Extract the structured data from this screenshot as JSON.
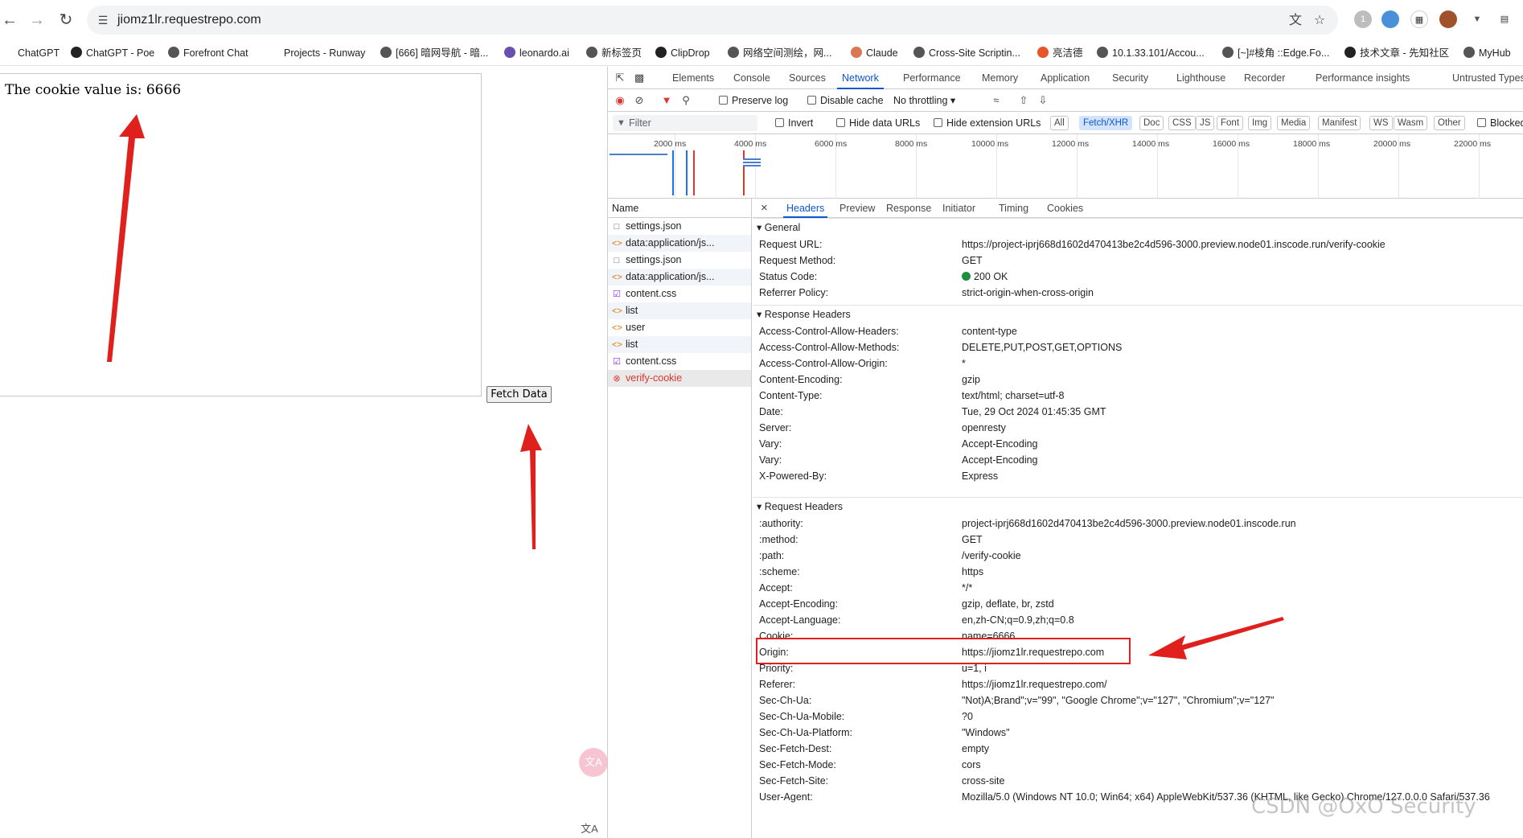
{
  "browser": {
    "url": "jiomz1lr.requestrepo.com",
    "bookmarks": [
      "ChatGPT",
      "ChatGPT - Poe",
      "Forefront Chat",
      "Projects - Runway",
      "[666] 暗网导航 - 暗...",
      "leonardo.ai",
      "新标签页",
      "ClipDrop",
      "网络空间测绘，网...",
      "Claude",
      "Cross-Site Scriptin...",
      "亮洁德",
      "10.1.33.101/Accou...",
      "[~]#棱角 ::Edge.Fo...",
      "技术文章 - 先知社区",
      "MyHub"
    ],
    "ext_badge": "1"
  },
  "page": {
    "cookie_message": "The cookie value is: 6666",
    "fetch_button": "Fetch Data",
    "float_translate": "文A",
    "float_translate2": "文A"
  },
  "devtools": {
    "tabs": [
      "Elements",
      "Console",
      "Sources",
      "Network",
      "Performance",
      "Memory",
      "Application",
      "Security",
      "Lighthouse",
      "Recorder",
      "Performance insights",
      "Untrusted Types"
    ],
    "active_tab": "Network",
    "toolbar": {
      "preserve_log": "Preserve log",
      "disable_cache": "Disable cache",
      "throttling": "No throttling"
    },
    "filter": {
      "placeholder": "Filter",
      "invert": "Invert",
      "hide_data_urls": "Hide data URLs",
      "hide_extension_urls": "Hide extension URLs",
      "chips": [
        "All",
        "Fetch/XHR",
        "Doc",
        "CSS",
        "JS",
        "Font",
        "Img",
        "Media",
        "Manifest",
        "WS",
        "Wasm",
        "Other"
      ],
      "selected_chip": "Fetch/XHR",
      "blocked": "Blocked"
    },
    "overview_ticks": [
      "2000 ms",
      "4000 ms",
      "6000 ms",
      "8000 ms",
      "10000 ms",
      "12000 ms",
      "14000 ms",
      "16000 ms",
      "18000 ms",
      "20000 ms",
      "22000 ms"
    ],
    "name_header": "Name",
    "requests": [
      {
        "name": "settings.json",
        "icon": "doc"
      },
      {
        "name": "data:application/js...",
        "icon": "script"
      },
      {
        "name": "settings.json",
        "icon": "doc"
      },
      {
        "name": "data:application/js...",
        "icon": "script"
      },
      {
        "name": "content.css",
        "icon": "css"
      },
      {
        "name": "list",
        "icon": "script"
      },
      {
        "name": "user",
        "icon": "script"
      },
      {
        "name": "list",
        "icon": "script"
      },
      {
        "name": "content.css",
        "icon": "css"
      },
      {
        "name": "verify-cookie",
        "icon": "error"
      }
    ],
    "detail_tabs": [
      "Headers",
      "Preview",
      "Response",
      "Initiator",
      "Timing",
      "Cookies"
    ],
    "general": {
      "title": "General",
      "rows": [
        {
          "k": "Request URL:",
          "v": "https://project-iprj668d1602d470413be2c4d596-3000.preview.node01.inscode.run/verify-cookie"
        },
        {
          "k": "Request Method:",
          "v": "GET"
        },
        {
          "k": "Status Code:",
          "v": "200 OK"
        },
        {
          "k": "Referrer Policy:",
          "v": "strict-origin-when-cross-origin"
        }
      ]
    },
    "response_headers": {
      "title": "Response Headers",
      "rows": [
        {
          "k": "Access-Control-Allow-Headers:",
          "v": "content-type"
        },
        {
          "k": "Access-Control-Allow-Methods:",
          "v": "DELETE,PUT,POST,GET,OPTIONS"
        },
        {
          "k": "Access-Control-Allow-Origin:",
          "v": "*"
        },
        {
          "k": "Content-Encoding:",
          "v": "gzip"
        },
        {
          "k": "Content-Type:",
          "v": "text/html; charset=utf-8"
        },
        {
          "k": "Date:",
          "v": "Tue, 29 Oct 2024 01:45:35 GMT"
        },
        {
          "k": "Server:",
          "v": "openresty"
        },
        {
          "k": "Vary:",
          "v": "Accept-Encoding"
        },
        {
          "k": "Vary:",
          "v": "Accept-Encoding"
        },
        {
          "k": "X-Powered-By:",
          "v": "Express"
        }
      ]
    },
    "request_headers": {
      "title": "Request Headers",
      "rows": [
        {
          "k": ":authority:",
          "v": "project-iprj668d1602d470413be2c4d596-3000.preview.node01.inscode.run"
        },
        {
          "k": ":method:",
          "v": "GET"
        },
        {
          "k": ":path:",
          "v": "/verify-cookie"
        },
        {
          "k": ":scheme:",
          "v": "https"
        },
        {
          "k": "Accept:",
          "v": "*/*"
        },
        {
          "k": "Accept-Encoding:",
          "v": "gzip, deflate, br, zstd"
        },
        {
          "k": "Accept-Language:",
          "v": "en,zh-CN;q=0.9,zh;q=0.8"
        },
        {
          "k": "Cookie:",
          "v": "name=6666"
        },
        {
          "k": "Origin:",
          "v": "https://jiomz1lr.requestrepo.com"
        },
        {
          "k": "Priority:",
          "v": "u=1, i"
        },
        {
          "k": "Referer:",
          "v": "https://jiomz1lr.requestrepo.com/"
        },
        {
          "k": "Sec-Ch-Ua:",
          "v": "\"Not)A;Brand\";v=\"99\", \"Google Chrome\";v=\"127\", \"Chromium\";v=\"127\""
        },
        {
          "k": "Sec-Ch-Ua-Mobile:",
          "v": "?0"
        },
        {
          "k": "Sec-Ch-Ua-Platform:",
          "v": "\"Windows\""
        },
        {
          "k": "Sec-Fetch-Dest:",
          "v": "empty"
        },
        {
          "k": "Sec-Fetch-Mode:",
          "v": "cors"
        },
        {
          "k": "Sec-Fetch-Site:",
          "v": "cross-site"
        },
        {
          "k": "User-Agent:",
          "v": "Mozilla/5.0 (Windows NT 10.0; Win64; x64) AppleWebKit/537.36 (KHTML, like Gecko) Chrome/127.0.0.0 Safari/537.36"
        }
      ]
    }
  },
  "watermark": "CSDN @OxO Security",
  "colors": {
    "accent": "#0b57d0",
    "error": "#dc362e",
    "annotation": "#e0201c",
    "status_ok": "#1e8e3e"
  }
}
